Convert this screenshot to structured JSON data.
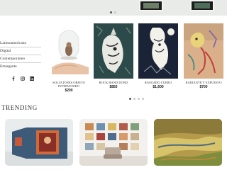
{
  "side_menu": {
    "items": [
      "Latinoamericano",
      "Digital",
      "Contemporáneo",
      "Emergente"
    ]
  },
  "social": {
    "icons": [
      "facebook-icon",
      "instagram-icon",
      "linkedin-icon"
    ]
  },
  "products": [
    {
      "title": "Soluciones Objeto Intervenido",
      "price": "$200"
    },
    {
      "title": "Rock Hand Dond",
      "price": "$850"
    },
    {
      "title": "Rasgado Cuero",
      "price": "$1,600"
    },
    {
      "title": "Radiante y Expuesto",
      "price": "$700"
    }
  ],
  "carousel": {
    "dot_count": 4,
    "active_index": 0
  },
  "banner_carousel": {
    "dot_count": 2,
    "active_index": 0
  },
  "trending": {
    "title": "TRENDING"
  },
  "colors": {
    "banner_bg": "#e9ebe8",
    "menu_divider": "#cfcfcf",
    "active_dot": "#555555"
  }
}
